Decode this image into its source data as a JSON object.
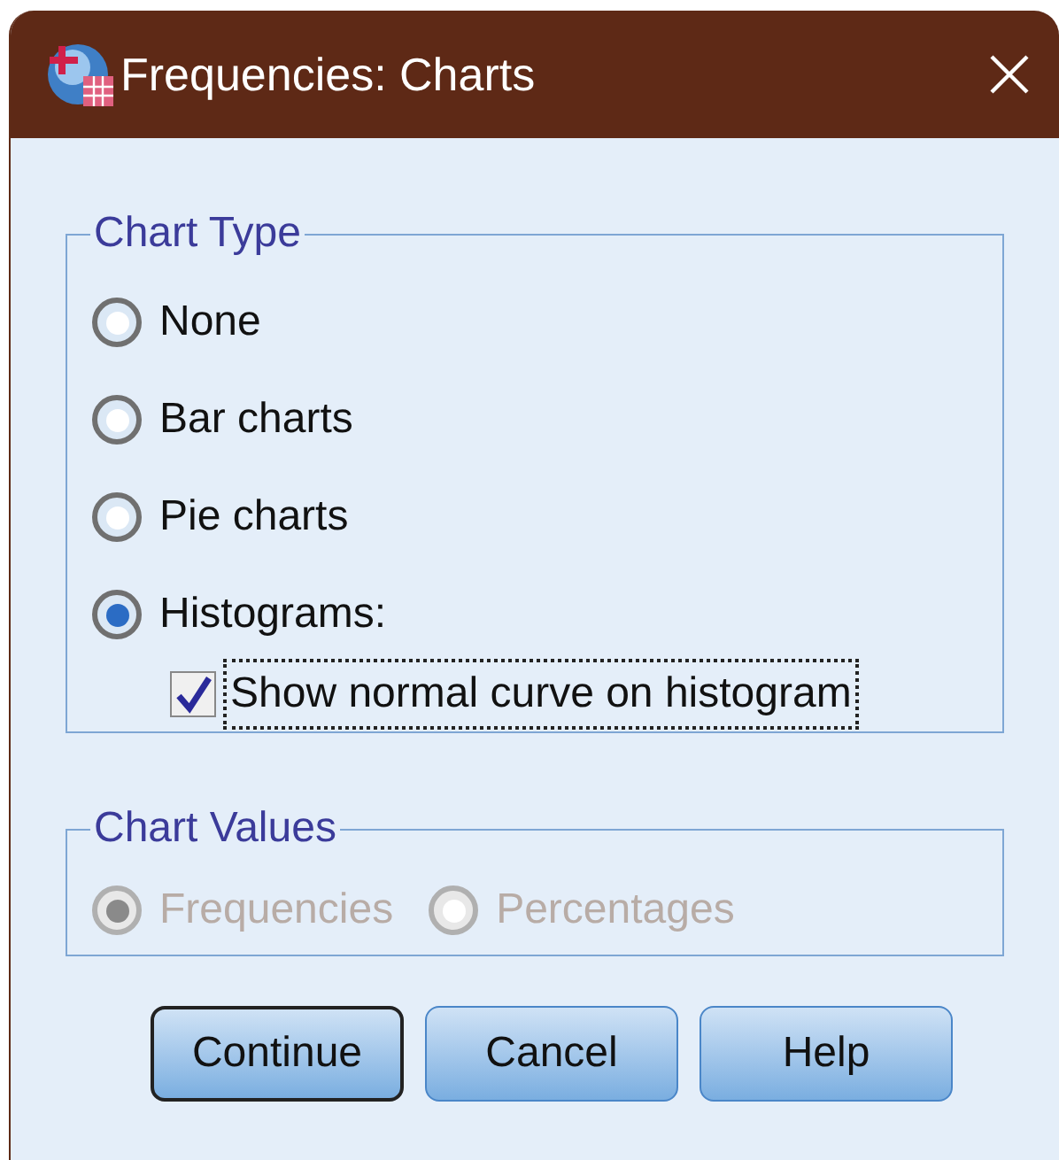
{
  "window": {
    "title": "Frequencies: Charts"
  },
  "chart_type": {
    "legend": "Chart Type",
    "options": [
      {
        "label": "None",
        "selected": false
      },
      {
        "label": "Bar charts",
        "selected": false
      },
      {
        "label": "Pie charts",
        "selected": false
      },
      {
        "label": "Histograms:",
        "selected": true
      }
    ],
    "normal_curve": {
      "label": "Show normal curve on histogram",
      "checked": true,
      "focused": true
    }
  },
  "chart_values": {
    "legend": "Chart Values",
    "disabled": true,
    "options": [
      {
        "label": "Frequencies",
        "selected": true
      },
      {
        "label": "Percentages",
        "selected": false
      }
    ]
  },
  "buttons": [
    {
      "label": "Continue",
      "default": true
    },
    {
      "label": "Cancel",
      "default": false
    },
    {
      "label": "Help",
      "default": false
    }
  ]
}
